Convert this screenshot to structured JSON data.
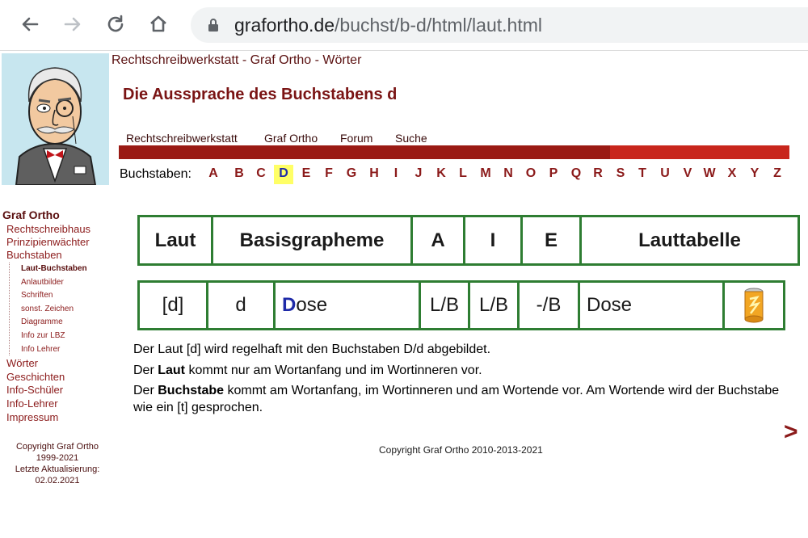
{
  "browser": {
    "url_host": "grafortho.de",
    "url_path": "/buchst/b-d/html/laut.html"
  },
  "header": {
    "site_title": "Rechtschreibwerkstatt - Graf Ortho - Wörter",
    "page_heading": "Die Aussprache des Buchstabens d",
    "nav": [
      "Rechtschreibwerkstatt",
      "Graf Ortho",
      "Forum",
      "Suche"
    ]
  },
  "alphabet": {
    "label": "Buchstaben:",
    "letters": [
      "A",
      "B",
      "C",
      "D",
      "E",
      "F",
      "G",
      "H",
      "I",
      "J",
      "K",
      "L",
      "M",
      "N",
      "O",
      "P",
      "Q",
      "R",
      "S",
      "T",
      "U",
      "V",
      "W",
      "X",
      "Y",
      "Z"
    ],
    "active": "D"
  },
  "sidebar": {
    "heading": "Graf Ortho",
    "items_top": [
      "Rechtschreibhaus",
      "Prinzipienwächter",
      "Buchstaben"
    ],
    "subitems": [
      "Laut-Buchstaben",
      "Anlautbilder",
      "Schriften",
      "sonst. Zeichen",
      "Diagramme",
      "Info zur LBZ",
      "Info Lehrer"
    ],
    "items_bottom": [
      "Wörter",
      "Geschichten",
      "Info-Schüler",
      "Info-Lehrer",
      "Impressum"
    ],
    "copyright_lines": [
      "Copyright  Graf Ortho",
      "1999-2021",
      "Letzte Aktualisierung:",
      "02.02.2021"
    ]
  },
  "table_header": [
    "Laut",
    "Basisgrapheme",
    "A",
    "I",
    "E",
    "Lauttabelle"
  ],
  "table_row": {
    "laut": "[d]",
    "graphem": "d",
    "example_first": "D",
    "example_rest": "ose",
    "a": "L/B",
    "i": "L/B",
    "e": "-/B",
    "lauttabelle": "Dose"
  },
  "text": {
    "p1": "Der Laut [d] wird regelhaft mit den Buchstaben D/d abgebildet.",
    "p2_pre": "Der ",
    "p2_bold": "Laut",
    "p2_post": " kommt nur am Wortanfang und im Wortinneren vor.",
    "p3_pre": "Der ",
    "p3_bold": "Buchstabe",
    "p3_post": " kommt am Wortanfang, im Wortinneren und am Wortende vor. Am Wortende wird der Buchstabe wie ein [t] gesprochen."
  },
  "footer": {
    "copyright": "Copyright Graf Ortho 2010-2013-2021",
    "next_arrow": ">"
  },
  "colors": {
    "brand_dark_red": "#9a1a14",
    "brand_red": "#c8261c",
    "table_green": "#2e7d32",
    "active_letter_bg": "#ffff66"
  }
}
